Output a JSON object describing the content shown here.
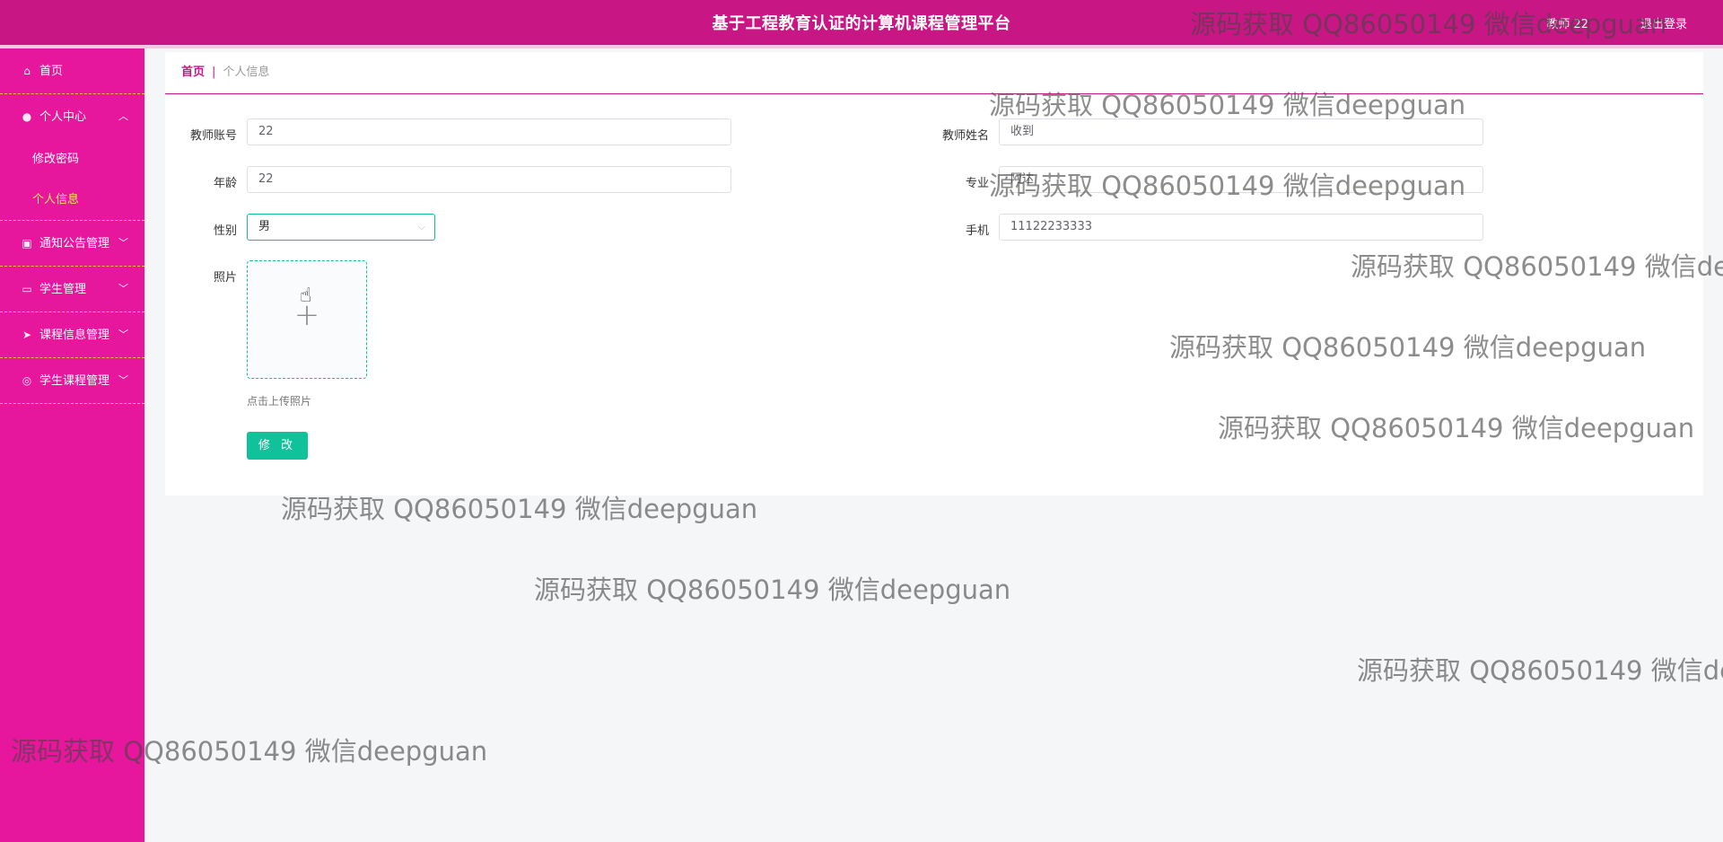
{
  "header": {
    "title": "基于工程教育认证的计算机课程管理平台",
    "user": "教师 22",
    "logout": "退出登录"
  },
  "sidebar": {
    "items": [
      {
        "label": "首页",
        "icon": "home-icon"
      },
      {
        "label": "个人中心",
        "icon": "user-icon",
        "expanded": true,
        "children": [
          {
            "label": "修改密码"
          },
          {
            "label": "个人信息",
            "active": true
          }
        ]
      },
      {
        "label": "通知公告管理",
        "icon": "clipboard-icon"
      },
      {
        "label": "学生管理",
        "icon": "id-card-icon"
      },
      {
        "label": "课程信息管理",
        "icon": "send-icon"
      },
      {
        "label": "学生课程管理",
        "icon": "circle-icon"
      }
    ]
  },
  "breadcrumb": {
    "home": "首页",
    "separator": "|",
    "current": "个人信息"
  },
  "form": {
    "account_label": "教师账号",
    "account_value": "22",
    "name_label": "教师姓名",
    "name_value": "收到",
    "age_label": "年龄",
    "age_value": "22",
    "major_label": "专业",
    "major_value": "阿达",
    "gender_label": "性别",
    "gender_value": "男",
    "phone_label": "手机",
    "phone_value": "11122233333",
    "photo_label": "照片",
    "photo_tip": "点击上传照片",
    "submit": "修 改"
  },
  "watermark": "源码获取 QQ86050149 微信deepguan",
  "colors": {
    "header": "#c81784",
    "sidebar": "#e6179c",
    "accent": "#0fc29a",
    "active": "#ffe65c"
  }
}
